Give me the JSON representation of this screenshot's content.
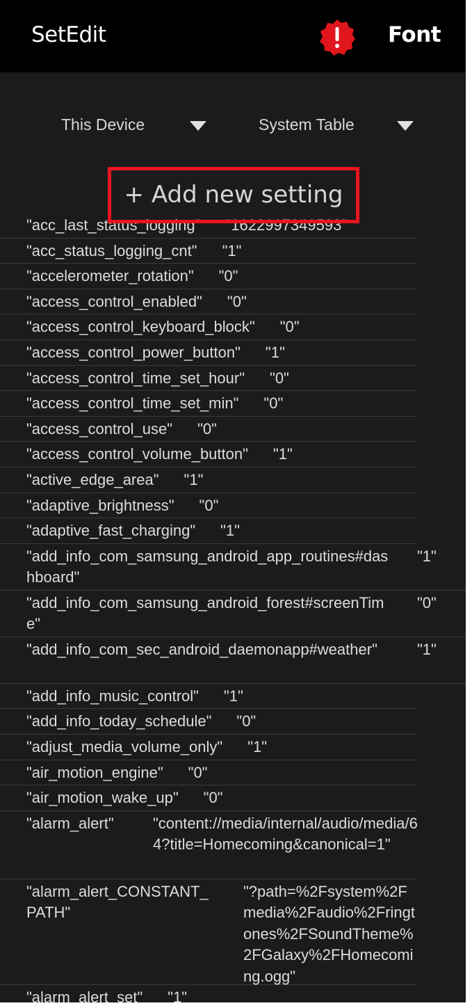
{
  "appbar": {
    "title": "SetEdit",
    "alert_icon": "alert-badge-icon",
    "font_label": "Font",
    "bg_color": "#000000",
    "alert_color": "#e0161c"
  },
  "filters": {
    "device": "This Device",
    "table": "System Table"
  },
  "add_setting_label": "+ Add new setting",
  "highlight_color": "#e81520",
  "settings": [
    {
      "name": "\"acc_last_status_logging\"",
      "value": "\"1622997349593\""
    },
    {
      "name": "\"acc_status_logging_cnt\"",
      "value": "\"1\""
    },
    {
      "name": "\"accelerometer_rotation\"",
      "value": "\"0\""
    },
    {
      "name": "\"access_control_enabled\"",
      "value": "\"0\""
    },
    {
      "name": "\"access_control_keyboard_block\"",
      "value": "\"0\""
    },
    {
      "name": "\"access_control_power_button\"",
      "value": "\"1\""
    },
    {
      "name": "\"access_control_time_set_hour\"",
      "value": "\"0\""
    },
    {
      "name": "\"access_control_time_set_min\"",
      "value": "\"0\""
    },
    {
      "name": "\"access_control_use\"",
      "value": "\"0\""
    },
    {
      "name": "\"access_control_volume_button\"",
      "value": "\"1\""
    },
    {
      "name": "\"active_edge_area\"",
      "value": "\"1\""
    },
    {
      "name": "\"adaptive_brightness\"",
      "value": "\"0\""
    },
    {
      "name": "\"adaptive_fast_charging\"",
      "value": "\"1\""
    },
    {
      "name": "\"add_info_com_samsung_android_app_routines#dashboard\"",
      "value": "\"1\""
    },
    {
      "name": "\"add_info_com_samsung_android_forest#screenTime\"",
      "value": "\"0\""
    },
    {
      "name": "\"add_info_com_sec_android_daemonapp#weather\"",
      "value": "\"1\""
    },
    {
      "name": "\"add_info_music_control\"",
      "value": "\"1\""
    },
    {
      "name": "\"add_info_today_schedule\"",
      "value": "\"0\""
    },
    {
      "name": "\"adjust_media_volume_only\"",
      "value": "\"1\""
    },
    {
      "name": "\"air_motion_engine\"",
      "value": "\"0\""
    },
    {
      "name": "\"air_motion_wake_up\"",
      "value": "\"0\""
    },
    {
      "name": "\"alarm_alert\"",
      "value": "\"content://media/internal/audio/media/64?title=Homecoming&canonical=1\""
    },
    {
      "name": "\"alarm_alert_CONSTANT_PATH\"",
      "value": "\"?path=%2Fsystem%2Fmedia%2Faudio%2Fringtones%2FSoundTheme%2FGalaxy%2FHomecoming.ogg\""
    },
    {
      "name": "\"alarm_alert_set\"",
      "value": "\"1\""
    }
  ]
}
